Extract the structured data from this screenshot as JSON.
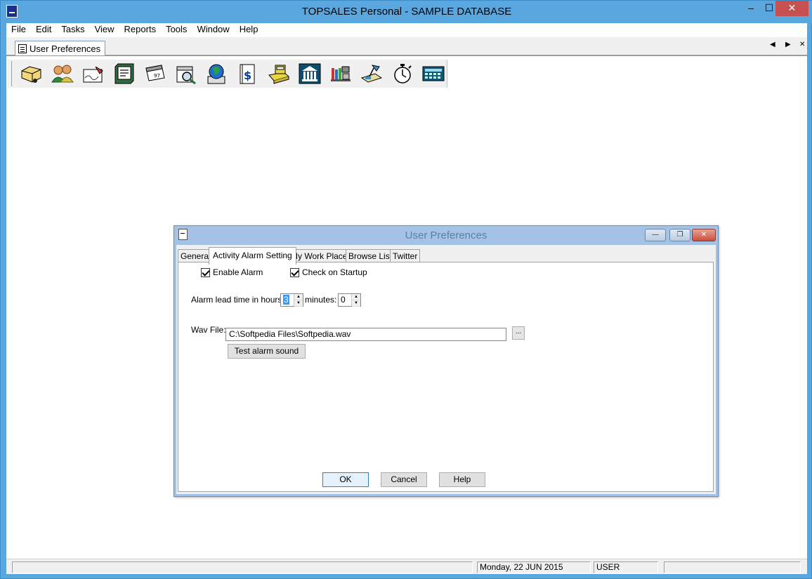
{
  "app": {
    "title": "TOPSALES Personal - SAMPLE DATABASE",
    "window_buttons": {
      "minimize": "–",
      "maximize": "☐",
      "close": "✕"
    }
  },
  "menu": [
    "File",
    "Edit",
    "Tasks",
    "View",
    "Reports",
    "Tools",
    "Window",
    "Help"
  ],
  "doc_tab": {
    "label": "User Preferences"
  },
  "tab_nav": {
    "left": "◀",
    "right": "▶",
    "close": "✕"
  },
  "toolbar": {
    "icons": [
      "open-folder-icon",
      "contacts-icon",
      "signature-icon",
      "address-book-icon",
      "calendar-icon",
      "search-magnifier-icon",
      "internet-globe-icon",
      "document-dollar-icon",
      "cash-register-icon",
      "bank-icon",
      "library-icon",
      "desk-lamp-icon",
      "stopwatch-icon",
      "calculator-icon"
    ]
  },
  "dialog": {
    "title": "User Preferences",
    "buttons": {
      "minimize": "—",
      "maximize": "❐",
      "close": "✕"
    },
    "tabs": [
      "General",
      "Activity Alarm Setting",
      "My Work Place",
      "Browse List",
      "Twitter"
    ],
    "active_tab": "Activity Alarm Setting",
    "enable_alarm_label": "Enable Alarm",
    "enable_alarm_checked": true,
    "check_startup_label": "Check on Startup",
    "check_startup_checked": true,
    "lead_time_label": "Alarm lead time in hours:",
    "hours_value": "3",
    "minutes_label": "minutes:",
    "minutes_value": "0",
    "wav_label": "Wav File:",
    "wav_value": "C:\\Softpedia Files\\Softpedia.wav",
    "browse_label": "...",
    "test_button": "Test alarm sound",
    "ok_button": "OK",
    "cancel_button": "Cancel",
    "help_button": "Help"
  },
  "status": {
    "date": "Monday, 22 JUN 2015",
    "user": "USER"
  }
}
